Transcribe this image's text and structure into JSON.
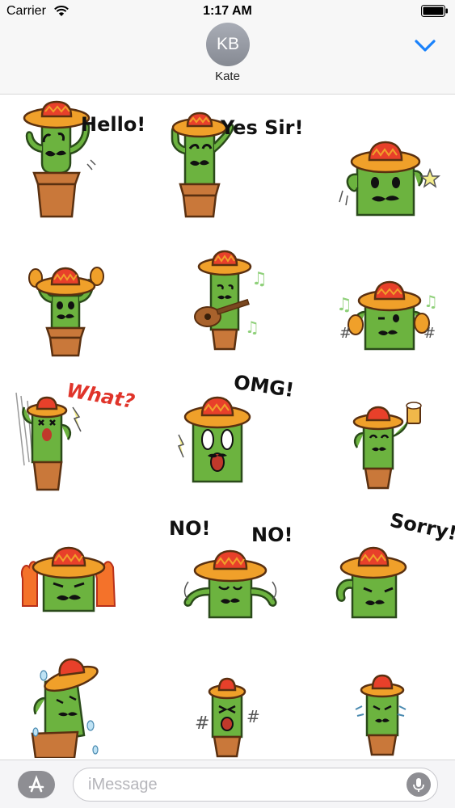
{
  "status_bar": {
    "carrier": "Carrier",
    "time": "1:17 AM"
  },
  "header": {
    "avatar_initials": "KB",
    "contact_name": "Kate"
  },
  "stickers": [
    {
      "caption": "Hello!"
    },
    {
      "caption": "Yes Sir!"
    },
    {
      "caption": ""
    },
    {
      "caption": ""
    },
    {
      "caption": ""
    },
    {
      "caption": ""
    },
    {
      "caption": "What?"
    },
    {
      "caption": "OMG!"
    },
    {
      "caption": ""
    },
    {
      "caption": ""
    },
    {
      "caption": "NO!",
      "caption2": "NO!"
    },
    {
      "caption": "Sorry!"
    },
    {
      "caption": ""
    },
    {
      "caption": ""
    },
    {
      "caption": ""
    }
  ],
  "composer": {
    "placeholder": "iMessage"
  },
  "colors": {
    "cactus": "#6cb33f",
    "pot": "#c9783a",
    "hat_brim": "#f0a02a",
    "hat_band": "#e8402a",
    "accent": "#1a82fb"
  },
  "icons": [
    "wifi-icon",
    "battery-icon",
    "chevron-down-icon",
    "app-store-icon",
    "microphone-icon"
  ]
}
